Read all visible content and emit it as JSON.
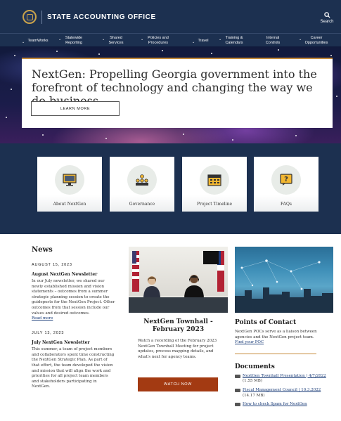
{
  "header": {
    "site_title": "STATE ACCOUNTING OFFICE",
    "search_label": "Search"
  },
  "nav": [
    {
      "label": "TeamWorks"
    },
    {
      "label": "Statewide Reporting"
    },
    {
      "label": "Shared Services"
    },
    {
      "label": "Policies and Procedures"
    },
    {
      "label": "Travel"
    },
    {
      "label": "Training & Calendars"
    },
    {
      "label": "Internal Controls"
    },
    {
      "label": "Career Opportunities"
    }
  ],
  "hero": {
    "heading": "NextGen: Propelling Georgia government into the forefront of technology and changing the way we do business.",
    "button_label": "LEARN MORE"
  },
  "tiles": [
    {
      "label": "About NextGen",
      "icon": "monitor-icon"
    },
    {
      "label": "Governance",
      "icon": "people-group-icon"
    },
    {
      "label": "Project Timeline",
      "icon": "calendar-icon"
    },
    {
      "label": "FAQs",
      "icon": "question-icon"
    }
  ],
  "news": {
    "title": "News",
    "items": [
      {
        "date": "AUGUST 15, 2023",
        "heading": "August NextGen Newsletter",
        "body": "In our July newsletter, we shared our newly established mission and vision statements – outcomes from a summer strategic planning session to create the guideposts for the NextGen Project. Other outcomes from that session include our values and desired outcomes.",
        "link": "Read more"
      },
      {
        "date": "JULY 13, 2023",
        "heading": "July NextGen Newsletter",
        "body": "This summer, a team of project members and collaborators spent time constructing the NextGen Strategic Plan. As part of that effort, the team developed the vision and mission that will align the work and priorities for all project team members and stakeholders participating in NextGen."
      }
    ]
  },
  "townhall": {
    "title": "NextGen Townhall - February 2023",
    "body": "Watch a recording of the February 2023 NextGen Townhall Meeting for project updates, process mapping details, and what's next for agency teams.",
    "button_label": "WATCH NOW"
  },
  "poc": {
    "title": "Points of Contact",
    "body": "NextGen POCs serve as a liaison between agencies and the NextGen project team.",
    "link": "Find your POC"
  },
  "documents": {
    "title": "Documents",
    "items": [
      {
        "link": "NextGen Townhall Presentation | 4/7/2022",
        "size": "(1.55 MB)"
      },
      {
        "link": "Fiscal Management Council | 10.3.2022",
        "size": "(14.17 MB)"
      },
      {
        "link": "How to check Spam for NextGen"
      }
    ]
  },
  "colors": {
    "navy": "#1c3050",
    "accent_gold": "#c58a3a",
    "watch_button": "#a33a12"
  }
}
